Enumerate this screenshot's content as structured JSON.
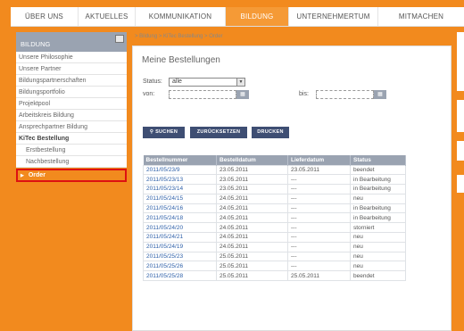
{
  "nav": {
    "tabs": [
      {
        "label": "ÜBER UNS"
      },
      {
        "label": "AKTUELLES"
      },
      {
        "label": "KOMMUNIKATION"
      },
      {
        "label": "BILDUNG"
      },
      {
        "label": "UNTERNEHMERTUM"
      },
      {
        "label": "MITMACHEN"
      }
    ]
  },
  "sidebar": {
    "title": "BILDUNG",
    "items": [
      {
        "label": "Unsere Philosophie"
      },
      {
        "label": "Unsere Partner"
      },
      {
        "label": "Bildungspartnerschaften"
      },
      {
        "label": "Bildungsportfolio"
      },
      {
        "label": "Projektpool"
      },
      {
        "label": "Arbeitskreis Bildung"
      },
      {
        "label": "Ansprechpartner Bildung"
      },
      {
        "label": "KiTec Bestellung"
      },
      {
        "label": "Erstbestellung"
      },
      {
        "label": "Nachbestellung"
      },
      {
        "label": "Order"
      }
    ]
  },
  "breadcrumb": "> Bildung > KiTec Bestellung > Order",
  "page_title": "Meine Bestellungen",
  "filters": {
    "status_label": "Status:",
    "status_value": "alle",
    "von_label": "von:",
    "bis_label": "bis:"
  },
  "buttons": {
    "search": "SUCHEN",
    "reset": "ZURÜCKSETZEN",
    "print": "DRUCKEN"
  },
  "table": {
    "headers": [
      "Bestellnummer",
      "Bestelldatum",
      "Lieferdatum",
      "Status"
    ],
    "rows": [
      [
        "2011/05/23/9",
        "23.05.2011",
        "23.05.2011",
        "beendet"
      ],
      [
        "2011/05/23/13",
        "23.05.2011",
        "---",
        "in Bearbeitung"
      ],
      [
        "2011/05/23/14",
        "23.05.2011",
        "---",
        "in Bearbeitung"
      ],
      [
        "2011/05/24/15",
        "24.05.2011",
        "---",
        "neu"
      ],
      [
        "2011/05/24/16",
        "24.05.2011",
        "---",
        "in Bearbeitung"
      ],
      [
        "2011/05/24/18",
        "24.05.2011",
        "---",
        "in Bearbeitung"
      ],
      [
        "2011/05/24/20",
        "24.05.2011",
        "---",
        "storniert"
      ],
      [
        "2011/05/24/21",
        "24.05.2011",
        "---",
        "neu"
      ],
      [
        "2011/05/24/19",
        "24.05.2011",
        "---",
        "neu"
      ],
      [
        "2011/05/25/23",
        "25.05.2011",
        "---",
        "neu"
      ],
      [
        "2011/05/25/26",
        "25.05.2011",
        "---",
        "neu"
      ],
      [
        "2011/05/25/28",
        "25.05.2011",
        "25.05.2011",
        "beendet"
      ]
    ]
  },
  "colors": {
    "page_bg": "#f28a1e",
    "active_tab": "#f59a36",
    "header_bg": "#9aa3b1",
    "button_bg": "#3e4e73",
    "highlight_border": "#dd1111"
  }
}
